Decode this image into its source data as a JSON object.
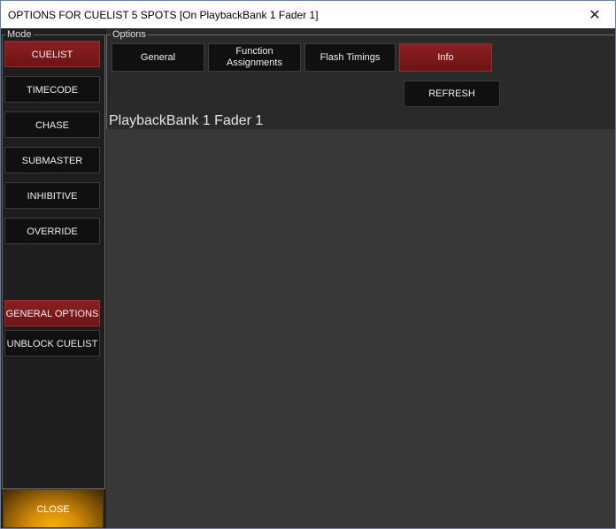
{
  "window": {
    "title": "OPTIONS FOR CUELIST 5 SPOTS  [On PlaybackBank 1 Fader 1]",
    "close_glyph": "✕"
  },
  "mode": {
    "label": "Mode",
    "buttons": [
      {
        "label": "CUELIST",
        "active": true
      },
      {
        "label": "TIMECODE",
        "active": false
      },
      {
        "label": "CHASE",
        "active": false
      },
      {
        "label": "SUBMASTER",
        "active": false
      },
      {
        "label": "INHIBITIVE",
        "active": false
      },
      {
        "label": "OVERRIDE",
        "active": false
      }
    ],
    "general_options": "GENERAL OPTIONS",
    "unblock_cuelist": "UNBLOCK CUELIST",
    "close": "CLOSE"
  },
  "options": {
    "label": "Options",
    "tabs": [
      {
        "label": "General",
        "active": false
      },
      {
        "label": "Function Assignments",
        "active": false
      },
      {
        "label": "Flash Timings",
        "active": false
      },
      {
        "label": "Info",
        "active": true
      }
    ],
    "refresh": "REFRESH",
    "fader_title": "PlaybackBank 1 Fader 1"
  },
  "colors": {
    "active_red": "#7c1a1c",
    "close_amber": "#f5b10e",
    "background": "#232323",
    "content_panel": "#383838"
  }
}
